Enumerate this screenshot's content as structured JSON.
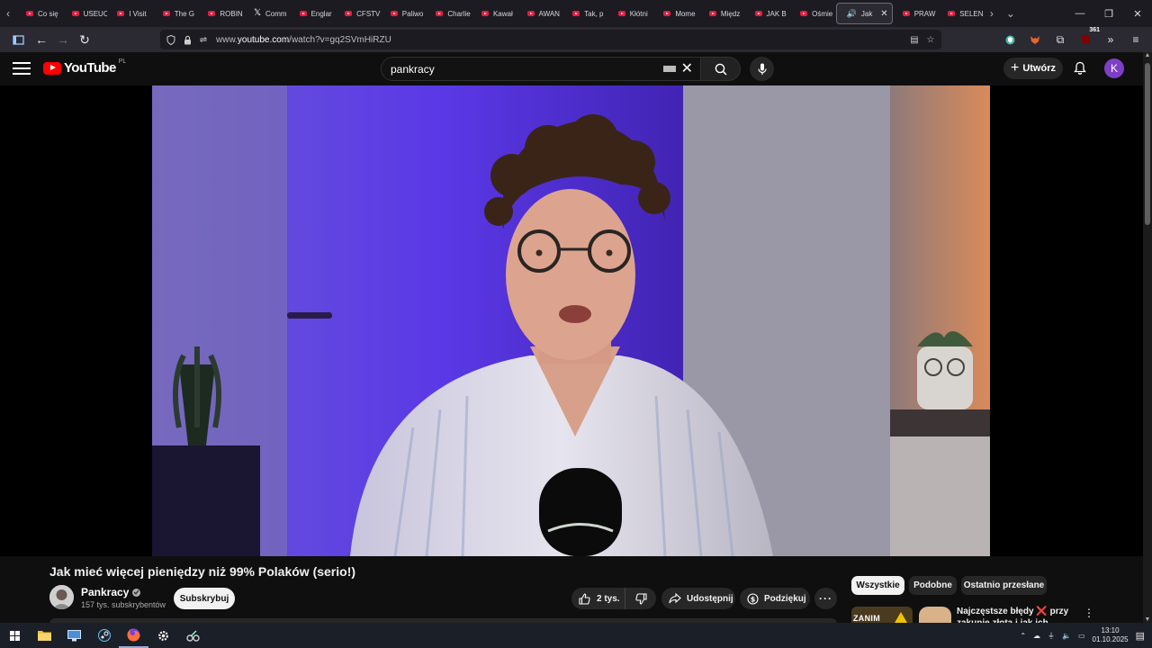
{
  "browser": {
    "tabs": [
      {
        "label": "Co się",
        "icon": "youtube-favicon"
      },
      {
        "label": "USEUC",
        "icon": "youtube-favicon"
      },
      {
        "label": "I Visit",
        "icon": "youtube-favicon"
      },
      {
        "label": "The G",
        "icon": "youtube-favicon"
      },
      {
        "label": "ROBIN",
        "icon": "youtube-favicon"
      },
      {
        "label": "Comm",
        "icon": "x-favicon"
      },
      {
        "label": "Englar",
        "icon": "youtube-favicon"
      },
      {
        "label": "CFSTV",
        "icon": "youtube-favicon"
      },
      {
        "label": "Paliwo",
        "icon": "youtube-favicon"
      },
      {
        "label": "Charlie",
        "icon": "youtube-favicon"
      },
      {
        "label": "Kawał",
        "icon": "youtube-favicon"
      },
      {
        "label": "AWAN",
        "icon": "youtube-favicon"
      },
      {
        "label": "Tak, p",
        "icon": "youtube-favicon"
      },
      {
        "label": "Kłótni",
        "icon": "youtube-favicon"
      },
      {
        "label": "Mome",
        "icon": "youtube-favicon"
      },
      {
        "label": "Międz",
        "icon": "youtube-favicon"
      },
      {
        "label": "JAK B",
        "icon": "youtube-favicon"
      },
      {
        "label": "Ośmie",
        "icon": "youtube-favicon"
      }
    ],
    "active_tab": {
      "label": "Jak",
      "icon": "youtube-favicon"
    },
    "tabs_after": [
      {
        "label": "PRAW",
        "icon": "youtube-favicon"
      },
      {
        "label": "SELEN",
        "icon": "youtube-favicon"
      }
    ],
    "url_prefix": "www.",
    "url_domain": "youtube.com",
    "url_path": "/watch?v=gq2SVmHiRZU",
    "extension_badge": "361"
  },
  "youtube": {
    "logo_text": "YouTube",
    "country_code": "PL",
    "search_value": "pankracy",
    "create_label": "Utwórz",
    "avatar_letter": "K"
  },
  "video": {
    "title": "Jak mieć więcej pieniędzy niż 99% Polaków (serio!)",
    "channel_name": "Pankracy",
    "subscribers": "157 tys. subskrybentów",
    "subscribe_label": "Subskrybuj",
    "likes": "2 tys.",
    "share_label": "Udostępnij",
    "thanks_label": "Podziękuj",
    "more_label": "···"
  },
  "chips": [
    "Wszystkie",
    "Podobne",
    "Ostatnio przesłane"
  ],
  "recommended": {
    "thumb_text": "ZANIM",
    "title_part1": "Najczęstsze błędy",
    "title_mark": "❌",
    "title_part2": "przy zakupie złota i jak ich uniknąć",
    "menu_label": "⋮"
  },
  "taskbar": {
    "time": "13:10",
    "date": "01.10.2025"
  },
  "colors": {
    "youtube_red": "#ff0000",
    "avatar_purple": "#7e3fc7",
    "background": "#0f0f0f"
  }
}
